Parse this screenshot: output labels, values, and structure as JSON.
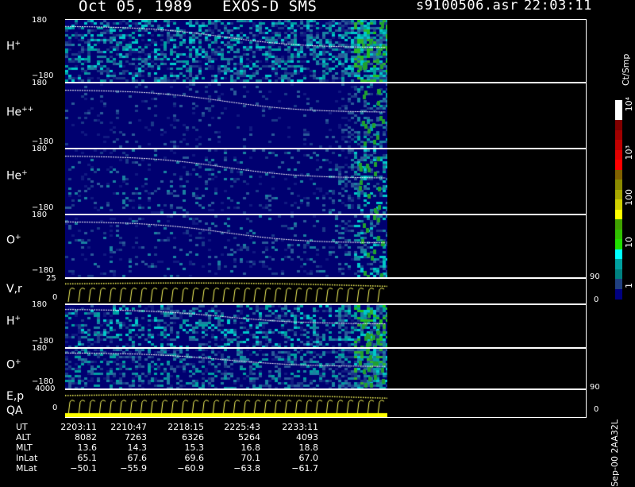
{
  "header": {
    "date": "Oct 05, 1989",
    "mission": "EXOS-D SMS",
    "filename": "s9100506.asr",
    "time": "22:03:11"
  },
  "panels": [
    {
      "species": "H",
      "charge": "+",
      "ymax": "180",
      "ymin": "−180"
    },
    {
      "species": "He",
      "charge": "++",
      "ymax": "180",
      "ymin": "−180"
    },
    {
      "species": "He",
      "charge": "+",
      "ymax": "180",
      "ymin": "−180"
    },
    {
      "species": "O",
      "charge": "+",
      "ymax": "180",
      "ymin": "−180"
    }
  ],
  "vr_panel": {
    "label": "V,r",
    "ymax": "25",
    "ymin": "0",
    "right_top": "90",
    "right_bottom": "0"
  },
  "lower_panels": [
    {
      "species": "H",
      "charge": "+",
      "ymax": "180",
      "ymin": "−180"
    },
    {
      "species": "O",
      "charge": "+",
      "ymax": "180",
      "ymin": "−180"
    }
  ],
  "ep_panel": {
    "label1": "E,p",
    "label2": "QA",
    "ymax": "4000",
    "ymin": "0",
    "right_top": "90",
    "right_bottom": "0"
  },
  "colorbar": {
    "unit": "Ct/Smp",
    "ticks": [
      "10⁴",
      "10³",
      "100",
      "10",
      "1"
    ],
    "colors": [
      "#ffffff",
      "#ffffff",
      "#800000",
      "#a00000",
      "#c00000",
      "#e00000",
      "#ff0000",
      "#806000",
      "#8a8a00",
      "#a8a800",
      "#d0d000",
      "#ffff00",
      "#40a000",
      "#30c000",
      "#20e000",
      "#00ffff",
      "#00a0a0",
      "#008080",
      "#204080",
      "#000080"
    ]
  },
  "footer": {
    "rows": [
      {
        "label": "UT",
        "values": [
          "2203:11",
          "2210:47",
          "2218:15",
          "2225:43",
          "2233:11"
        ]
      },
      {
        "label": "ALT",
        "values": [
          "8082",
          "7263",
          "6326",
          "5264",
          "4093"
        ]
      },
      {
        "label": "MLT",
        "values": [
          "13.6",
          "14.3",
          "15.3",
          "16.8",
          "18.8"
        ]
      },
      {
        "label": "InLat",
        "values": [
          "65.1",
          "67.6",
          "69.6",
          "70.1",
          "67.0"
        ]
      },
      {
        "label": "MLat",
        "values": [
          "−50.1",
          "−55.9",
          "−60.9",
          "−63.8",
          "−61.7"
        ]
      }
    ],
    "stamp": "Sep-00 2AA32L"
  }
}
